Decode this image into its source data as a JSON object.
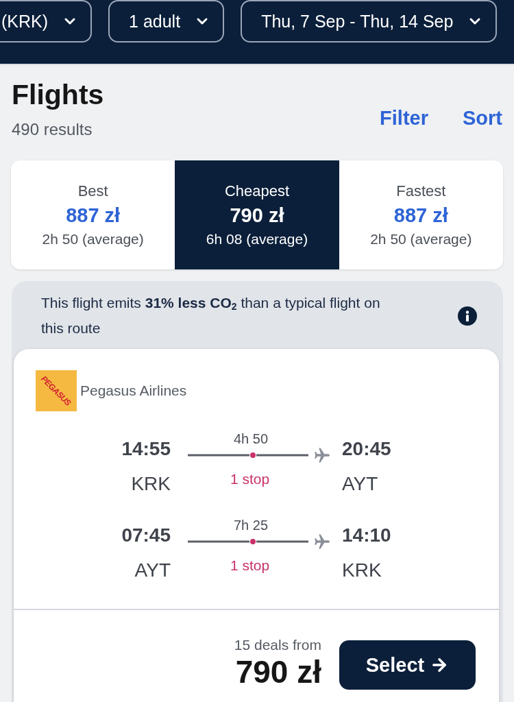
{
  "search_bar": {
    "fields": [
      {
        "value": "(KRK)"
      },
      {
        "value": "1 adult"
      },
      {
        "value": "Thu, 7 Sep - Thu, 14 Sep"
      }
    ]
  },
  "results_header": {
    "title": "Flights",
    "count": "490 results",
    "actions": [
      "Filter",
      "Sort"
    ]
  },
  "sort_tabs": [
    {
      "label": "Best",
      "price": "887 zł",
      "duration": "2h 50 (average)",
      "selected": false
    },
    {
      "label": "Cheapest",
      "price": "790 zł",
      "duration": "6h 08 (average)",
      "selected": true
    },
    {
      "label": "Fastest",
      "price": "887 zł",
      "duration": "2h 50 (average)",
      "selected": false
    }
  ],
  "eco_notice": {
    "text": "This flight emits **31% less CO**$_{2}$ than a typical flight on this route"
  },
  "flight_card": {
    "airline": {
      "logo_text": "PEGASUS",
      "name": "Pegasus Airlines"
    },
    "legs": [
      {
        "depart_time": "14:55",
        "depart_airport": "KRK",
        "duration": "4h 50",
        "stops": "1 stop",
        "arrive_time": "20:45",
        "arrive_airport": "AYT"
      },
      {
        "depart_time": "07:45",
        "depart_airport": "AYT",
        "duration": "7h 25",
        "stops": "1 stop",
        "arrive_time": "14:10",
        "arrive_airport": "KRK"
      }
    ],
    "deals": "15 deals from",
    "price": "790 zł",
    "select_label": "Select"
  }
}
